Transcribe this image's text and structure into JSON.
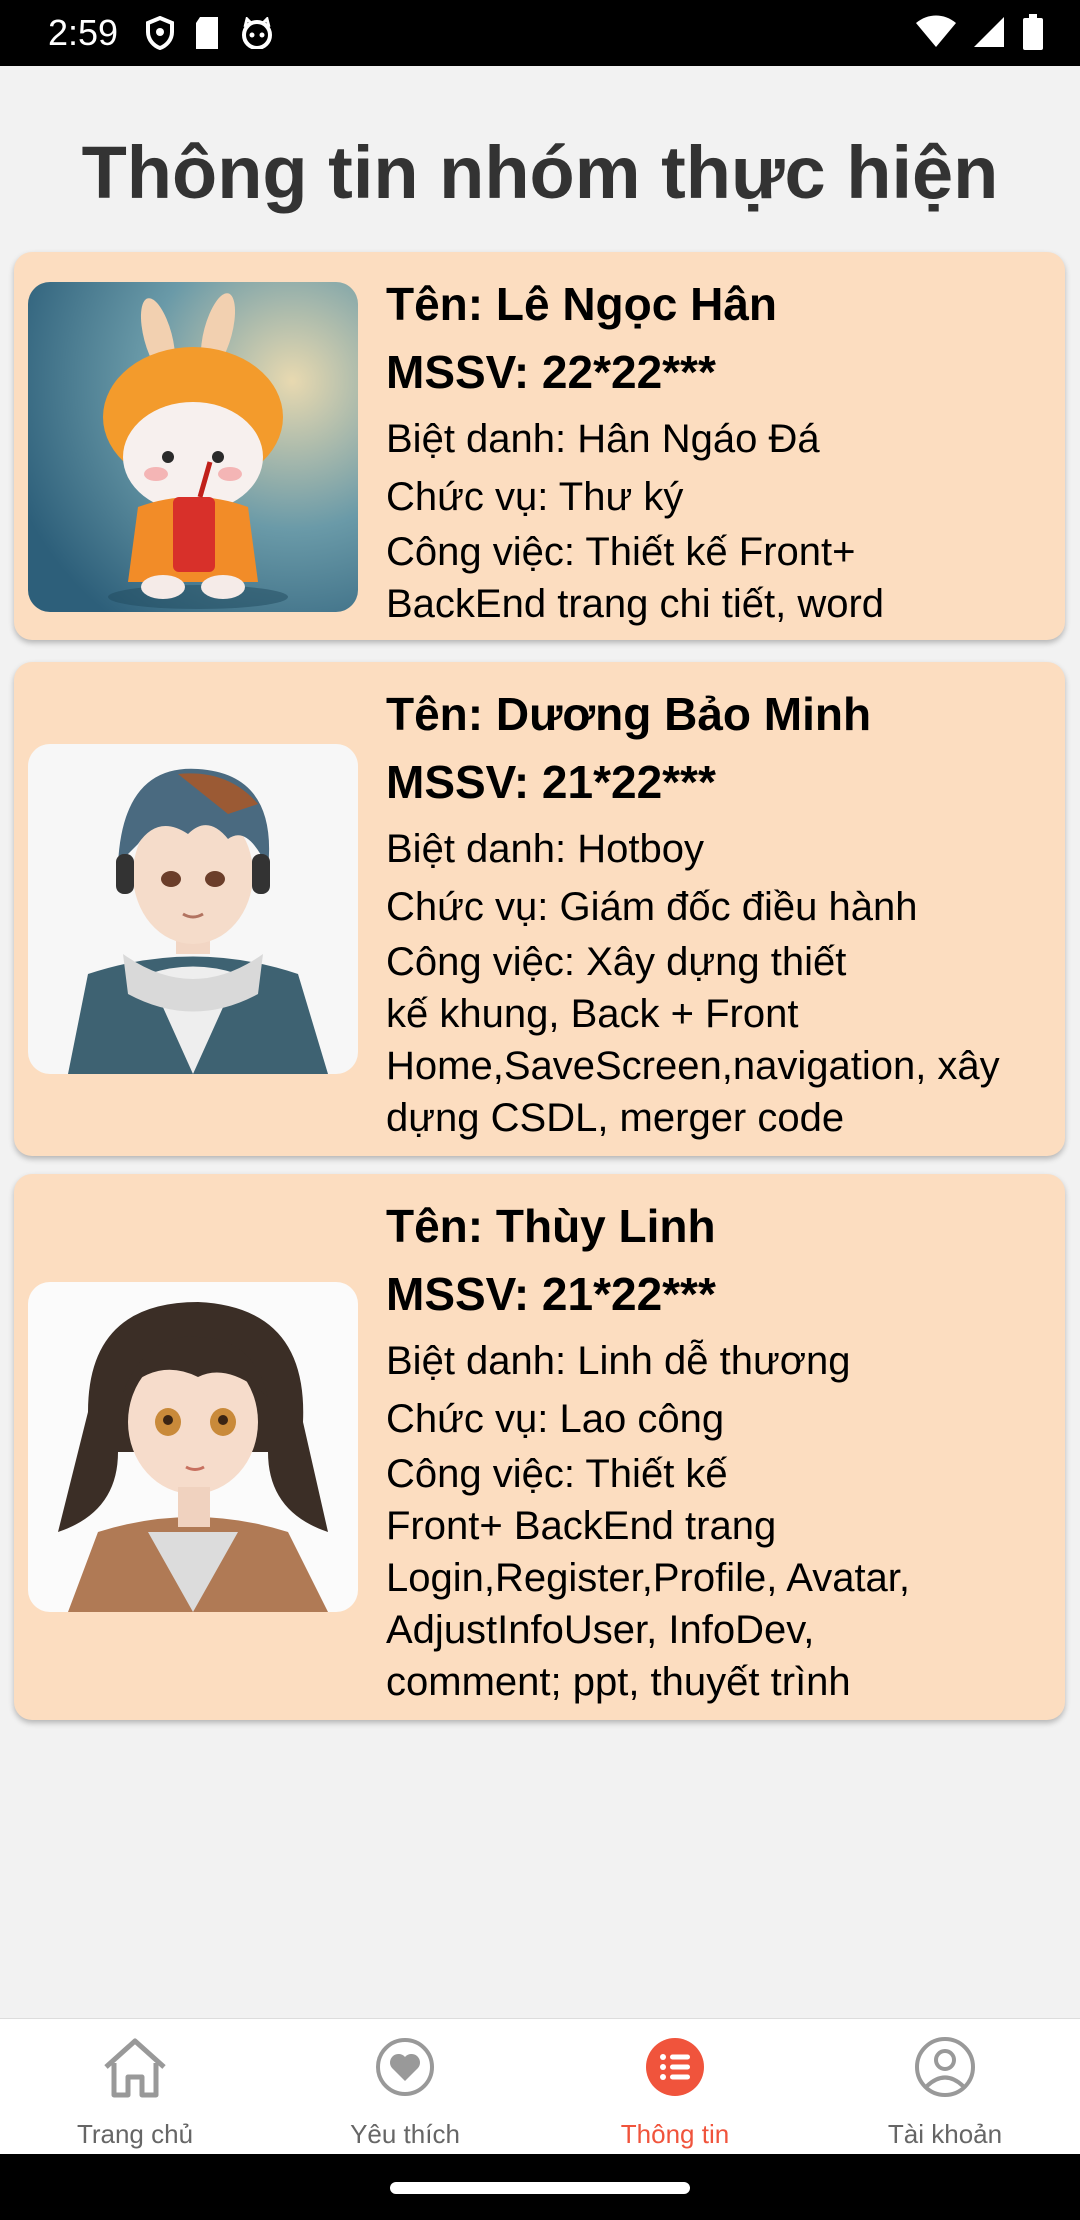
{
  "status": {
    "time": "2:59"
  },
  "page_title": "Thông tin nhóm thực hiện",
  "members": [
    {
      "name": "Tên: Lê Ngọc Hân",
      "mssv": "MSSV: 22*22***",
      "nickname": "Biệt danh: Hân Ngáo Đá",
      "role": "Chức vụ: Thư ký",
      "work_lines": [
        "Công việc: Thiết kế Front+",
        "BackEnd trang chi tiết, word"
      ]
    },
    {
      "name": "Tên: Dương Bảo Minh",
      "mssv": "MSSV: 21*22***",
      "nickname": "Biệt danh: Hotboy",
      "role": "Chức vụ: Giám đốc điều hành",
      "work_lines": [
        "Công việc: Xây dựng thiết",
        "kế khung, Back + Front",
        "Home,SaveScreen,navigation, xây",
        "dựng CSDL, merger code"
      ]
    },
    {
      "name": "Tên: Thùy Linh",
      "mssv": "MSSV: 21*22***",
      "nickname": "Biệt danh: Linh dễ thương",
      "role": "Chức vụ: Lao công",
      "work_lines": [
        "Công việc: Thiết kế",
        "Front+ BackEnd trang",
        "Login,Register,Profile, Avatar,",
        "AdjustInfoUser, InfoDev,",
        "comment;  ppt, thuyết trình"
      ]
    }
  ],
  "nav": [
    {
      "label": "Trang chủ",
      "icon": "home-icon",
      "active": false
    },
    {
      "label": "Yêu thích",
      "icon": "heart-icon",
      "active": false
    },
    {
      "label": "Thông tin",
      "icon": "list-icon",
      "active": true
    },
    {
      "label": "Tài khoản",
      "icon": "account-icon",
      "active": false
    }
  ],
  "colors": {
    "accent": "#f0543c",
    "card_bg": "#fcddc0",
    "page_bg": "#f2f2f2"
  }
}
